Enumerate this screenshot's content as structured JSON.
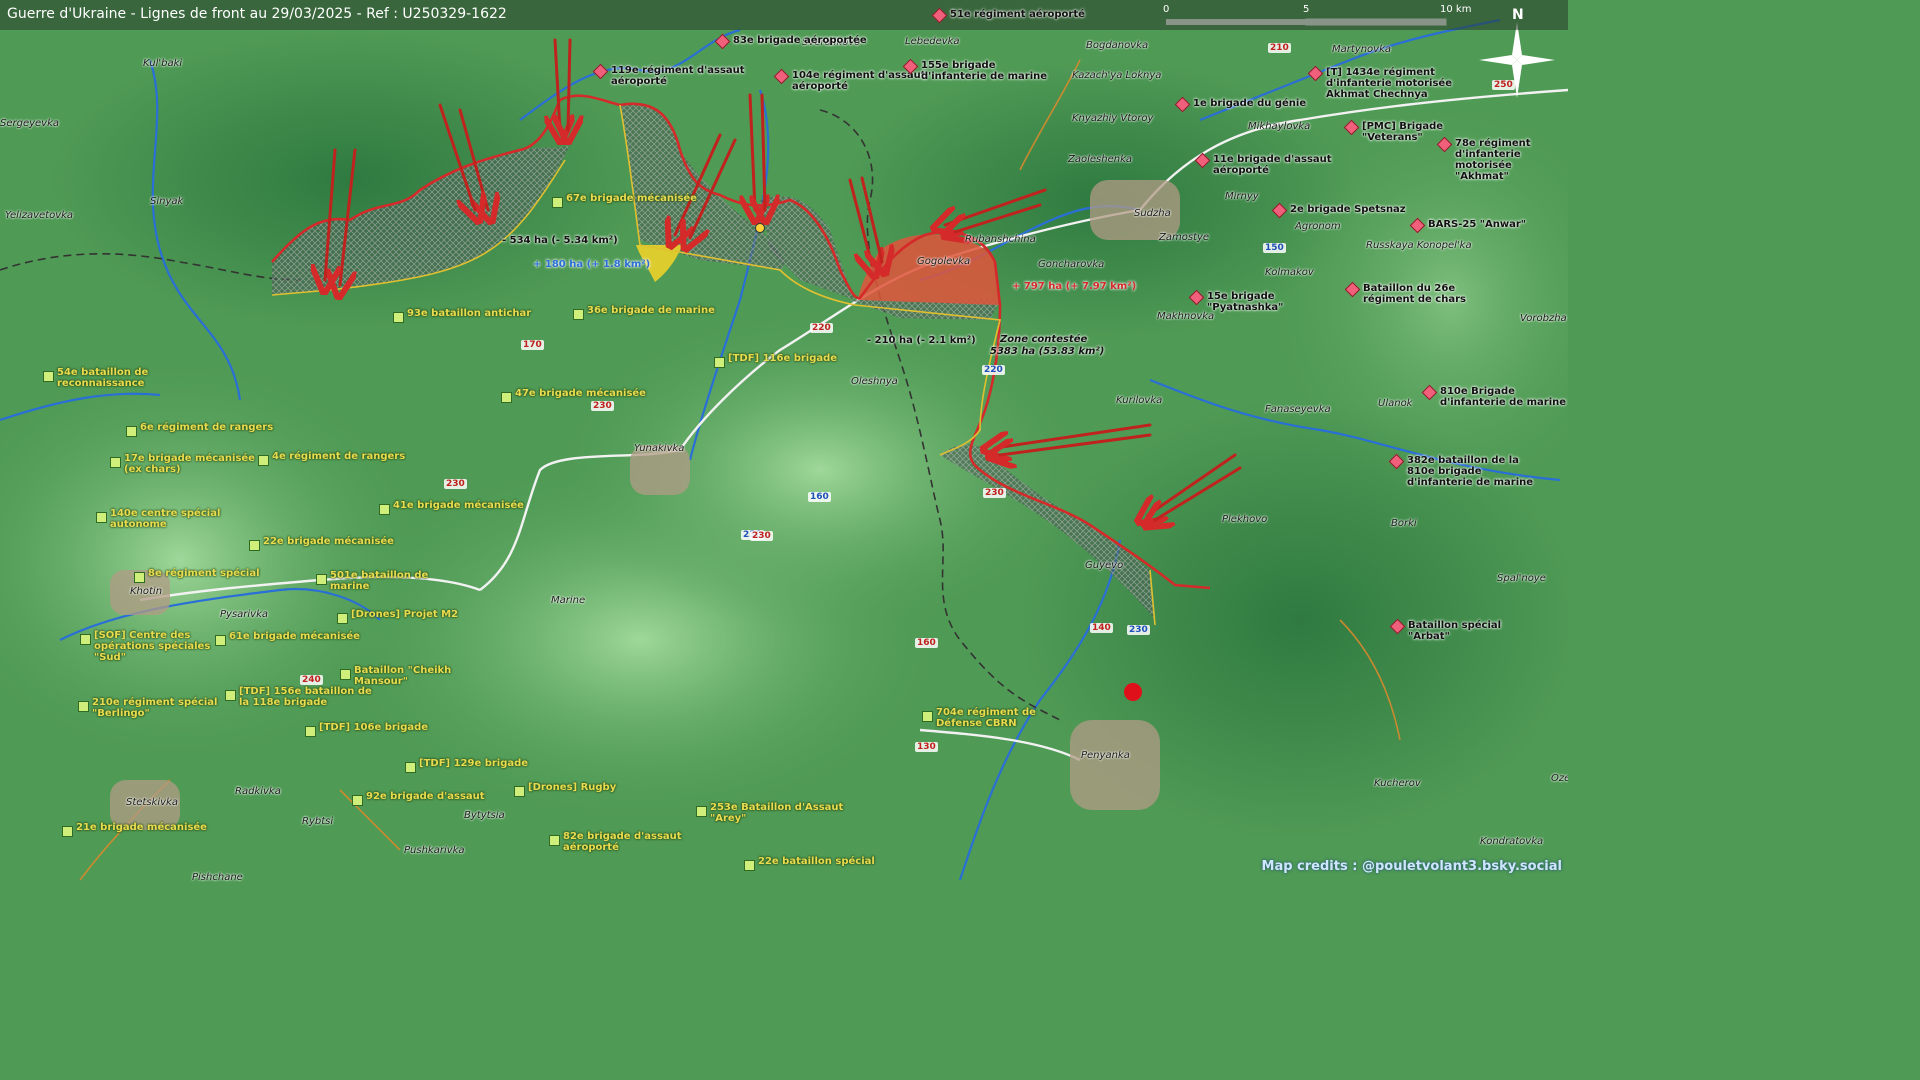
{
  "title": "Guerre d'Ukraine - Lignes de front au 29/03/2025 - Ref : U250329-1622",
  "scale": {
    "zero": "0",
    "mid": "5",
    "end": "10 km"
  },
  "north_label": "N",
  "credits": "Map credits : @pouletvolant3.bsky.social",
  "colors": {
    "terrain": "#4f9a55",
    "frontline": "#d42a2a",
    "ukraine_unit": "#cfee7a",
    "russia_unit": "#f0607a",
    "unit_label_ua": "#e8dc50",
    "unit_label_ru": "#111111",
    "gain_ru": "#e0553c",
    "gain_ua": "#ecd22a",
    "water": "#2a6fd6",
    "road_main": "#f2f2f2",
    "road_secondary": "#d98a2c"
  },
  "places": [
    {
      "name": "Kul'baki"
    },
    {
      "name": "Sergeyevka"
    },
    {
      "name": "Sinyak"
    },
    {
      "name": "Yelizavetovka"
    },
    {
      "name": "Sverdlikovo"
    },
    {
      "name": "Lebedevka"
    },
    {
      "name": "Bogdanovka"
    },
    {
      "name": "Martynovka"
    },
    {
      "name": "Kazach'ya Loknya"
    },
    {
      "name": "Knyazhiy Vtoroy"
    },
    {
      "name": "Mikhaylovka"
    },
    {
      "name": "Zaoleshenka"
    },
    {
      "name": "Sudzha"
    },
    {
      "name": "Mirnyy"
    },
    {
      "name": "Zamostye"
    },
    {
      "name": "Agronom"
    },
    {
      "name": "Rubanshchina"
    },
    {
      "name": "Gogolevka"
    },
    {
      "name": "Goncharovka"
    },
    {
      "name": "Kolmakov"
    },
    {
      "name": "Russkaya Konopel'ka"
    },
    {
      "name": "Makhnovka"
    },
    {
      "name": "Vorobzha"
    },
    {
      "name": "Oleshnya"
    },
    {
      "name": "Kurilovka"
    },
    {
      "name": "Fanaseyevka"
    },
    {
      "name": "Ulanok"
    },
    {
      "name": "Yunakivka"
    },
    {
      "name": "Plekhovo"
    },
    {
      "name": "Borki"
    },
    {
      "name": "Guyevo"
    },
    {
      "name": "Marine"
    },
    {
      "name": "Khotin"
    },
    {
      "name": "Pysarivka"
    },
    {
      "name": "Spal'noye"
    },
    {
      "name": "Penyanka"
    },
    {
      "name": "Kucherov"
    },
    {
      "name": "Stetskivka"
    },
    {
      "name": "Radkivka"
    },
    {
      "name": "Rybtsi"
    },
    {
      "name": "Bytytsia"
    },
    {
      "name": "Pushkarivka"
    },
    {
      "name": "Pishchane"
    },
    {
      "name": "Kondratovka"
    },
    {
      "name": "Oze"
    }
  ],
  "units_ru": [
    {
      "name": "51e régiment aéroporté"
    },
    {
      "name": "83e brigade aéroportée"
    },
    {
      "name": "119e régiment d'assaut aéroporté"
    },
    {
      "name": "104e régiment d'assaut aéroporté"
    },
    {
      "name": "155e brigade d'infanterie de marine"
    },
    {
      "name": "[T] 1434e régiment d'infanterie motorisée Akhmat Chechnya"
    },
    {
      "name": "1e brigade du génie"
    },
    {
      "name": "[PMC] Brigade \"Veterans\""
    },
    {
      "name": "78e régiment d'infanterie motorisée \"Akhmat\""
    },
    {
      "name": "11e brigade d'assaut aéroporté"
    },
    {
      "name": "2e brigade Spetsnaz"
    },
    {
      "name": "BARS-25 \"Anwar\""
    },
    {
      "name": "15e brigade \"Pyatnashka\""
    },
    {
      "name": "Bataillon du 26e régiment de chars"
    },
    {
      "name": "810e Brigade d'infanterie de marine"
    },
    {
      "name": "382e bataillon de la 810e brigade d'infanterie de marine"
    },
    {
      "name": "Bataillon spécial \"Arbat\""
    }
  ],
  "units_ua": [
    {
      "name": "67e brigade mécanisée"
    },
    {
      "name": "93e bataillon antichar"
    },
    {
      "name": "36e brigade de marine"
    },
    {
      "name": "[TDF] 116e brigade"
    },
    {
      "name": "47e brigade mécanisée"
    },
    {
      "name": "54e bataillon de reconnaissance"
    },
    {
      "name": "6e régiment de rangers"
    },
    {
      "name": "4e régiment de rangers"
    },
    {
      "name": "17e brigade mécanisée (ex chars)"
    },
    {
      "name": "41e brigade mécanisée"
    },
    {
      "name": "140e centre spécial autonome"
    },
    {
      "name": "22e brigade mécanisée"
    },
    {
      "name": "8e régiment spécial"
    },
    {
      "name": "501e bataillon de marine"
    },
    {
      "name": "[SOF] Centre des opérations spéciales \"Sud\""
    },
    {
      "name": "61e brigade mécanisée"
    },
    {
      "name": "[Drones] Projet M2"
    },
    {
      "name": "Bataillon \"Cheikh Mansour\""
    },
    {
      "name": "210e régiment spécial \"Berlingo\""
    },
    {
      "name": "[TDF] 156e bataillon de la 118e brigade"
    },
    {
      "name": "[TDF] 106e brigade"
    },
    {
      "name": "[TDF] 129e brigade"
    },
    {
      "name": "92e brigade d'assaut"
    },
    {
      "name": "[Drones] Rugby"
    },
    {
      "name": "21e brigade mécanisée"
    },
    {
      "name": "253e Bataillon d'Assaut \"Arey\""
    },
    {
      "name": "82e brigade d'assaut aéroporté"
    },
    {
      "name": "22e bataillon spécial"
    },
    {
      "name": "704e régiment de Défense CBRN"
    }
  ],
  "area_labels": [
    {
      "text": "- 534 ha (- 5.34 km²)"
    },
    {
      "text": "+ 180 ha (+ 1.8 km²)"
    },
    {
      "text": "+ 797 ha (+ 7.97 km²)"
    },
    {
      "text": "- 210 ha (- 2.1 km²)"
    },
    {
      "text": "Zone contestée"
    },
    {
      "text": "5383 ha (53.83 km²)"
    }
  ],
  "elevations": [
    "210",
    "250",
    "150",
    "170",
    "220",
    "220",
    "230",
    "230",
    "230",
    "160",
    "230",
    "230",
    "230",
    "140",
    "160",
    "240",
    "130"
  ]
}
